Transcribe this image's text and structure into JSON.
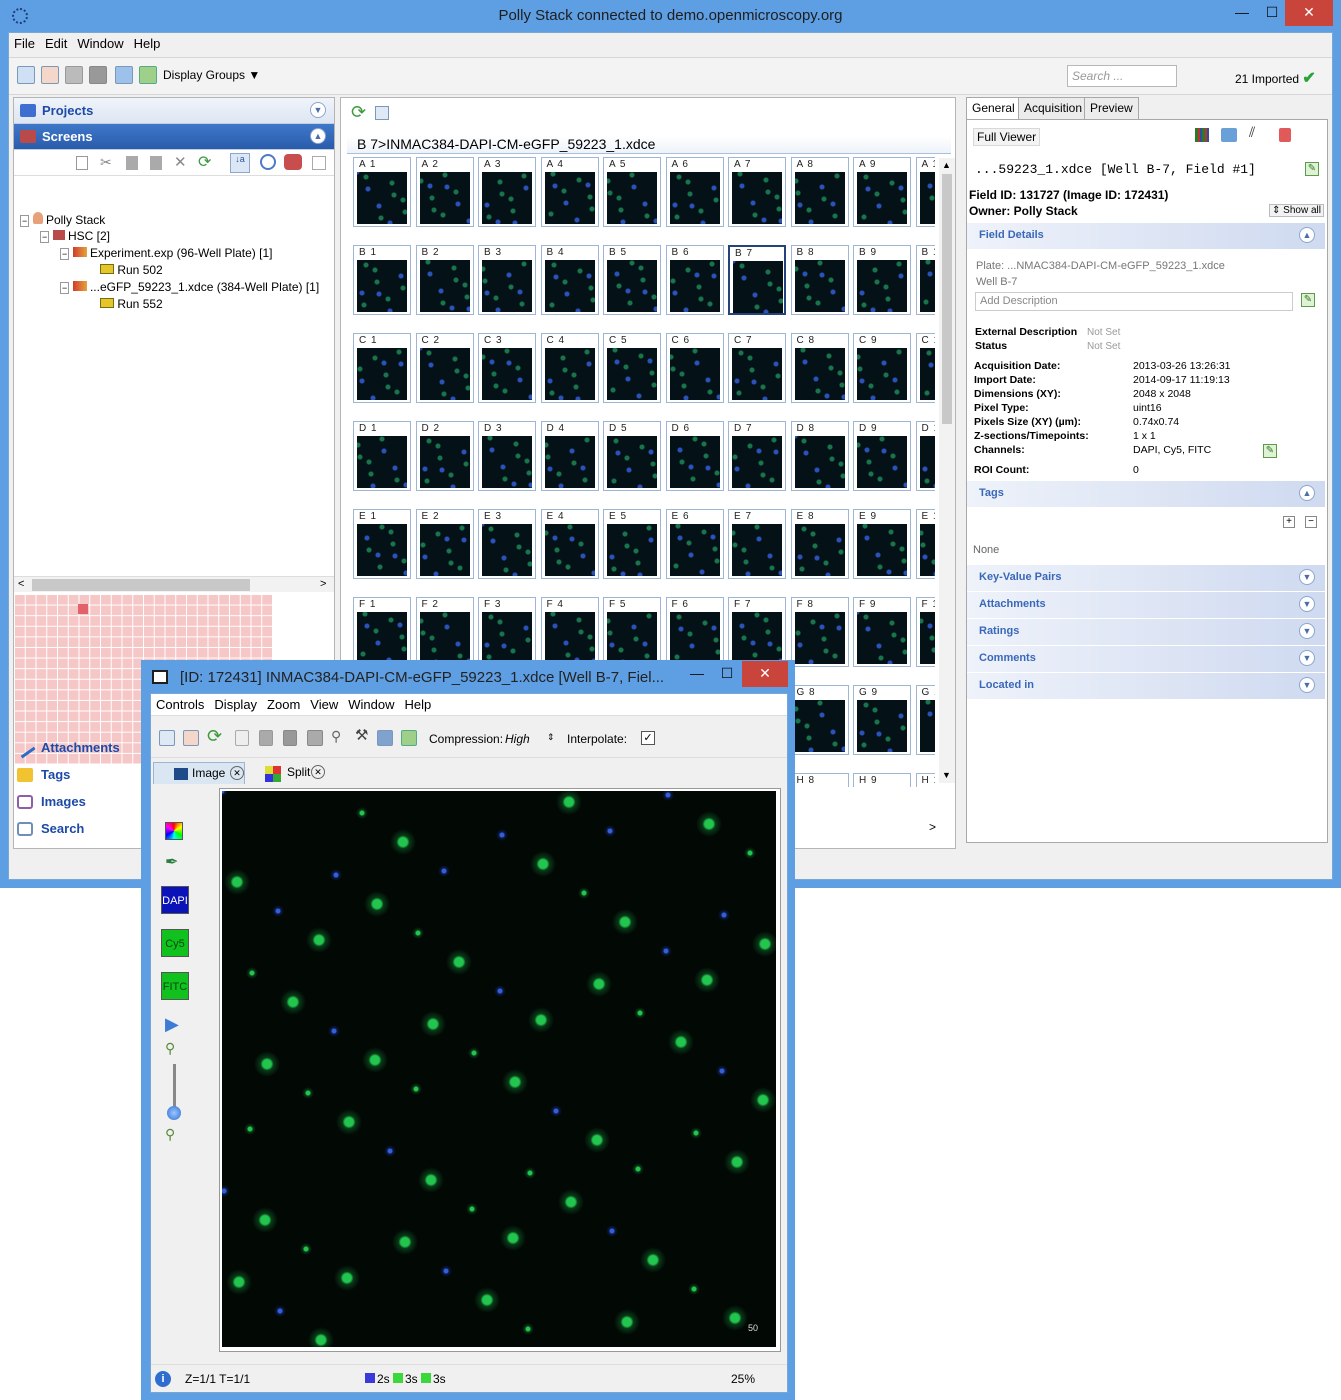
{
  "main_window": {
    "title": "Polly Stack connected to demo.openmicroscopy.org",
    "controls": {
      "minimize": "—",
      "maximize": "☐",
      "close": "✕"
    },
    "menu": [
      "File",
      "Edit",
      "Window",
      "Help"
    ],
    "toolbar": {
      "display_groups": "Display Groups",
      "search_placeholder": "Search ...",
      "imported": "21 Imported"
    }
  },
  "left_panel": {
    "projects": "Projects",
    "screens": "Screens",
    "tree": {
      "root": "Polly Stack",
      "hsc": "HSC [2]",
      "exp1": "Experiment.exp (96-Well Plate) [1]",
      "run1": "Run 502",
      "exp2": "...eGFP_59223_1.xdce (384-Well Plate) [1]",
      "run2": "Run 552"
    },
    "bottom": [
      "Attachments",
      "Tags",
      "Images",
      "Search"
    ]
  },
  "center": {
    "plate_title": "B 7>INMAC384-DAPI-CM-eGFP_59223_1.xdce",
    "rows": [
      "A",
      "B",
      "C",
      "D",
      "E",
      "F",
      "G",
      "H"
    ],
    "cols": [
      "1",
      "2",
      "3",
      "4",
      "5",
      "6",
      "7",
      "8",
      "9",
      "1"
    ],
    "selected_well": "B 7"
  },
  "right_panel": {
    "tabs": [
      "General",
      "Acquisition",
      "Preview"
    ],
    "full_viewer": "Full Viewer",
    "image_name": "...59223_1.xdce [Well B-7, Field #1]",
    "field_id": "Field ID: 131727 (Image ID: 172431)",
    "owner": "Owner: Polly Stack",
    "show_all": "Show all",
    "field_details": "Field Details",
    "plate": "Plate: ...NMAC384-DAPI-CM-eGFP_59223_1.xdce",
    "well": "Well B-7",
    "add_description": "Add Description",
    "external_description_label": "External Description",
    "external_description_value": "Not Set",
    "status_label": "Status",
    "status_value": "Not Set",
    "details": [
      {
        "k": "Acquisition Date:",
        "v": "2013-03-26 13:26:31"
      },
      {
        "k": "Import Date:",
        "v": "2014-09-17 11:19:13"
      },
      {
        "k": "Dimensions (XY):",
        "v": "2048 x 2048"
      },
      {
        "k": "Pixel Type:",
        "v": "uint16"
      },
      {
        "k": "Pixels Size (XY) (µm):",
        "v": "0.74x0.74"
      },
      {
        "k": "Z-sections/Timepoints:",
        "v": "1 x 1"
      },
      {
        "k": "Channels:",
        "v": "DAPI, Cy5, FITC"
      }
    ],
    "roi_label": "ROI Count:",
    "roi_value": "0",
    "tags": "Tags",
    "tags_none": "None",
    "sections": [
      "Key-Value Pairs",
      "Attachments",
      "Ratings",
      "Comments",
      "Located in"
    ]
  },
  "viewer": {
    "title": "[ID: 172431] INMAC384-DAPI-CM-eGFP_59223_1.xdce [Well B-7, Fiel...",
    "menu": [
      "Controls",
      "Display",
      "Zoom",
      "View",
      "Window",
      "Help"
    ],
    "compression_label": "Compression:",
    "compression_value": "High",
    "interpolate_label": "Interpolate:",
    "tabs": [
      "Image",
      "Split"
    ],
    "channels": [
      "DAPI",
      "Cy5",
      "FITC"
    ],
    "scale": "50",
    "status_zt": "Z=1/1 T=1/1",
    "status_times": [
      "2s",
      "3s",
      "3s"
    ],
    "zoom": "25%"
  }
}
